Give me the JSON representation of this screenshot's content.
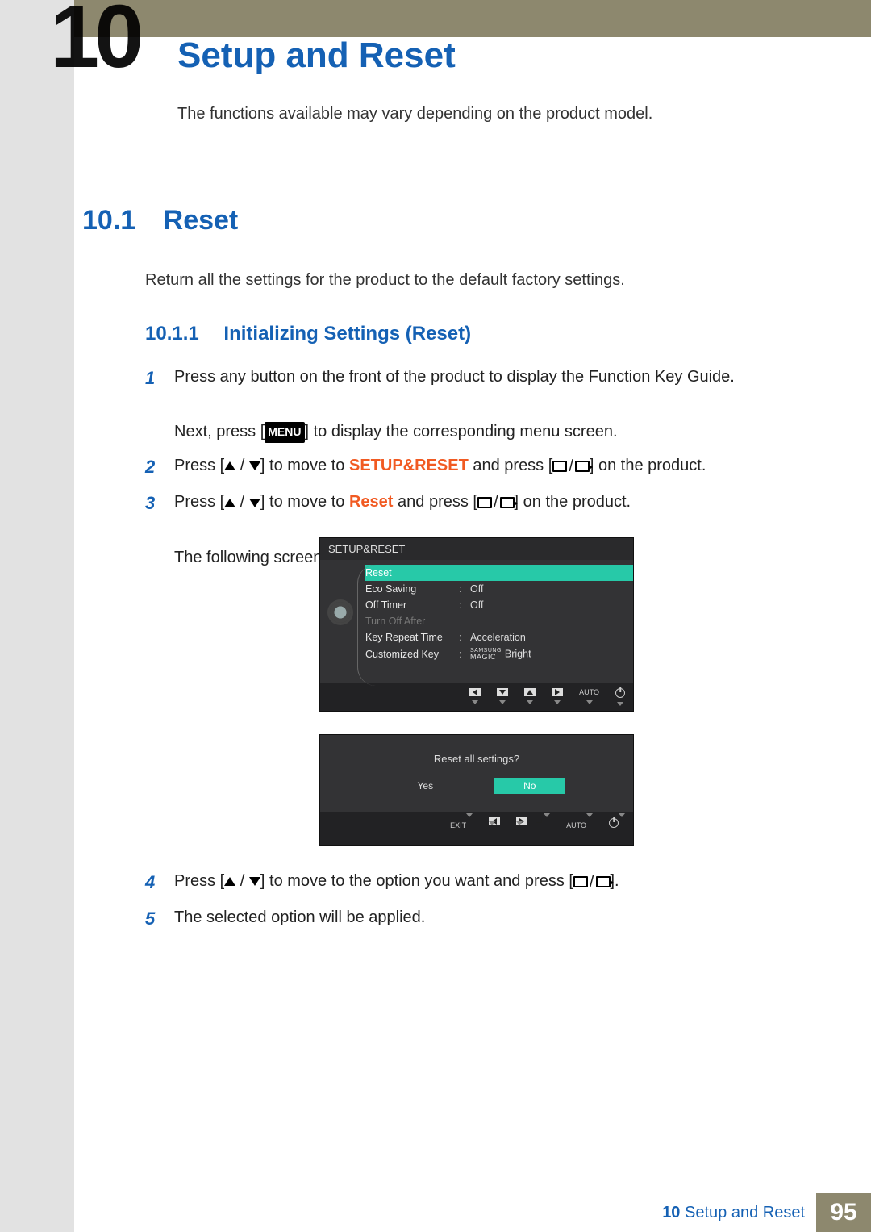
{
  "chapter_number": "10",
  "page_title": "Setup and Reset",
  "intro": "The functions available may vary depending on the product model.",
  "section": {
    "num": "10.1",
    "title": "Reset"
  },
  "section_desc": "Return all the settings for the product to the default factory settings.",
  "subsection": {
    "num": "10.1.1",
    "title": "Initializing Settings (Reset)"
  },
  "steps": [
    {
      "n": "1",
      "line1": "Press any button on the front of the product to display the Function Key Guide.",
      "line2_pre": "Next, press [",
      "line2_menu": "MENU",
      "line2_post": "] to display the corresponding menu screen."
    },
    {
      "n": "2",
      "pre": "Press [",
      "mid": "] to move to ",
      "target": "SETUP&RESET",
      "after": " and press [",
      "end": "] on the product."
    },
    {
      "n": "3",
      "pre": "Press [",
      "mid": "] to move to ",
      "target": "Reset",
      "after": " and press [",
      "end": "] on the product.",
      "extra": "The following screen will appear."
    }
  ],
  "osd": {
    "title": "SETUP&RESET",
    "rows": [
      {
        "label": "Reset",
        "value": "",
        "selected": true
      },
      {
        "label": "Eco Saving",
        "value": "Off"
      },
      {
        "label": "Off Timer",
        "value": "Off"
      },
      {
        "label": "Turn Off After",
        "value": "",
        "dim": true
      },
      {
        "label": "Key Repeat Time",
        "value": "Acceleration"
      },
      {
        "label": "Customized Key",
        "value_prefix_top": "SAMSUNG",
        "value_prefix_bottom": "MAGIC",
        "value": "Bright"
      }
    ],
    "footer": [
      "left",
      "down",
      "up",
      "right",
      "AUTO",
      "power"
    ]
  },
  "dialog": {
    "question": "Reset all settings?",
    "yes": "Yes",
    "no": "No",
    "footer": [
      "EXIT",
      "left",
      "right",
      "enter",
      "AUTO",
      "power"
    ]
  },
  "steps2": [
    {
      "n": "4",
      "pre": "Press [",
      "mid": "] to move to the option you want and press [",
      "end": "]."
    },
    {
      "n": "5",
      "text": "The selected option will be applied."
    }
  ],
  "footer": {
    "label_pre": "10",
    "label": "Setup and Reset",
    "page": "95"
  }
}
